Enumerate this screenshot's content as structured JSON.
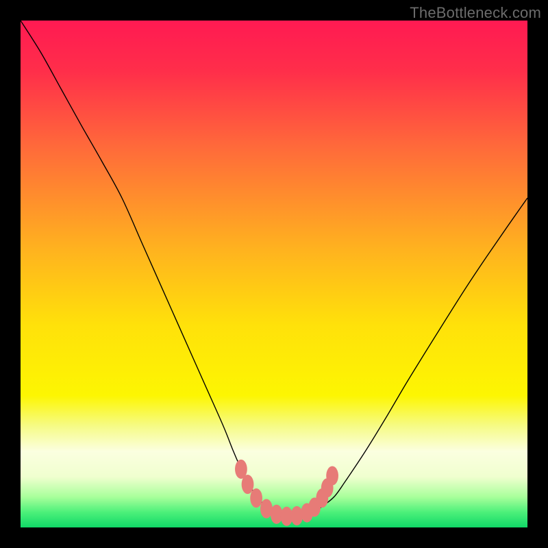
{
  "watermark": "TheBottleneck.com",
  "chart_data": {
    "type": "line",
    "title": "",
    "xlabel": "",
    "ylabel": "",
    "xlim": [
      0,
      100
    ],
    "ylim": [
      0,
      100
    ],
    "grid": false,
    "legend": null,
    "background_gradient": {
      "stops": [
        {
          "offset": 0.0,
          "color": "#ff1a52"
        },
        {
          "offset": 0.1,
          "color": "#ff2e4a"
        },
        {
          "offset": 0.25,
          "color": "#ff6a3a"
        },
        {
          "offset": 0.45,
          "color": "#ffb21f"
        },
        {
          "offset": 0.6,
          "color": "#ffe10a"
        },
        {
          "offset": 0.74,
          "color": "#fdf602"
        },
        {
          "offset": 0.8,
          "color": "#f6fb86"
        },
        {
          "offset": 0.85,
          "color": "#fbffe0"
        },
        {
          "offset": 0.9,
          "color": "#f0ffcf"
        },
        {
          "offset": 0.94,
          "color": "#a8ff9b"
        },
        {
          "offset": 0.97,
          "color": "#4cf07a"
        },
        {
          "offset": 1.0,
          "color": "#10d867"
        }
      ]
    },
    "curve_color": "#000000",
    "curve_width": 1.4,
    "curve": {
      "description": "Bottleneck-style V curve: steep descent on left, flat valley with soft-red markers near x≈45–60, rise on right, higher on left edge than right edge.",
      "x": [
        0,
        4,
        8,
        12,
        16,
        20,
        24,
        28,
        32,
        36,
        40,
        42,
        44,
        46,
        48,
        50,
        52,
        54,
        56,
        58,
        60,
        62,
        64,
        68,
        72,
        76,
        80,
        84,
        88,
        92,
        96,
        100
      ],
      "y": [
        100.0,
        93.7,
        86.5,
        79.3,
        72.3,
        65.0,
        56.0,
        47.0,
        38.0,
        29.0,
        20.0,
        15.0,
        10.5,
        7.0,
        4.5,
        3.0,
        2.3,
        2.2,
        2.5,
        3.2,
        4.5,
        6.2,
        9.0,
        15.0,
        21.5,
        28.3,
        34.8,
        41.2,
        47.5,
        53.5,
        59.3,
        65.0
      ]
    },
    "markers": {
      "color": "#e77b77",
      "rx": 1.2,
      "ry": 1.9,
      "points": [
        {
          "x": 43.5,
          "y": 11.5
        },
        {
          "x": 44.8,
          "y": 8.5
        },
        {
          "x": 46.5,
          "y": 5.8
        },
        {
          "x": 48.5,
          "y": 3.7
        },
        {
          "x": 50.5,
          "y": 2.6
        },
        {
          "x": 52.5,
          "y": 2.2
        },
        {
          "x": 54.5,
          "y": 2.3
        },
        {
          "x": 56.5,
          "y": 2.9
        },
        {
          "x": 58.0,
          "y": 4.0
        },
        {
          "x": 59.5,
          "y": 5.8
        },
        {
          "x": 60.5,
          "y": 7.8
        },
        {
          "x": 61.5,
          "y": 10.2
        }
      ]
    }
  }
}
